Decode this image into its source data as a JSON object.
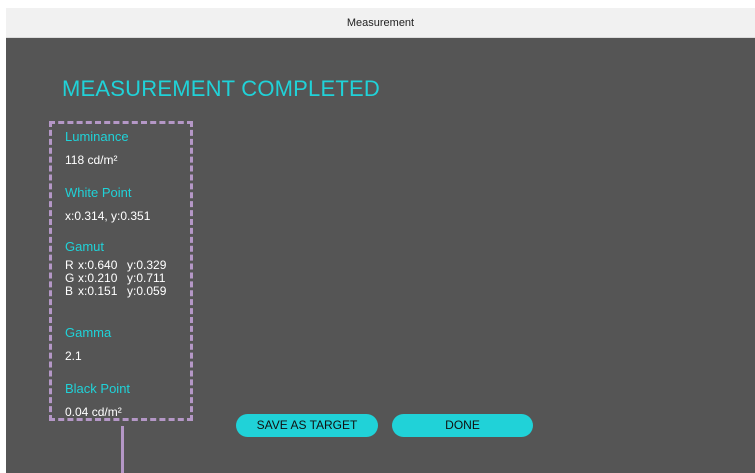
{
  "window": {
    "title": "Measurement"
  },
  "headline": "MEASUREMENT COMPLETED",
  "results": {
    "luminance": {
      "label": "Luminance",
      "value": "118 cd/m²"
    },
    "white_point": {
      "label": "White Point",
      "value": "x:0.314, y:0.351"
    },
    "gamut": {
      "label": "Gamut",
      "rows": [
        {
          "channel": "R",
          "x": "x:0.640",
          "y": "y:0.329"
        },
        {
          "channel": "G",
          "x": "x:0.210",
          "y": "y:0.711"
        },
        {
          "channel": "B",
          "x": "x:0.151",
          "y": "y:0.059"
        }
      ]
    },
    "gamma": {
      "label": "Gamma",
      "value": "2.1"
    },
    "black_point": {
      "label": "Black Point",
      "value": "0.04 cd/m²"
    }
  },
  "buttons": {
    "save_as_target": "SAVE AS TARGET",
    "done": "DONE"
  },
  "colors": {
    "accent": "#20d2d8",
    "background": "#555555",
    "titlebar": "#f1f1f1",
    "panel_border": "#b497c6",
    "value_text": "#ffffff"
  }
}
